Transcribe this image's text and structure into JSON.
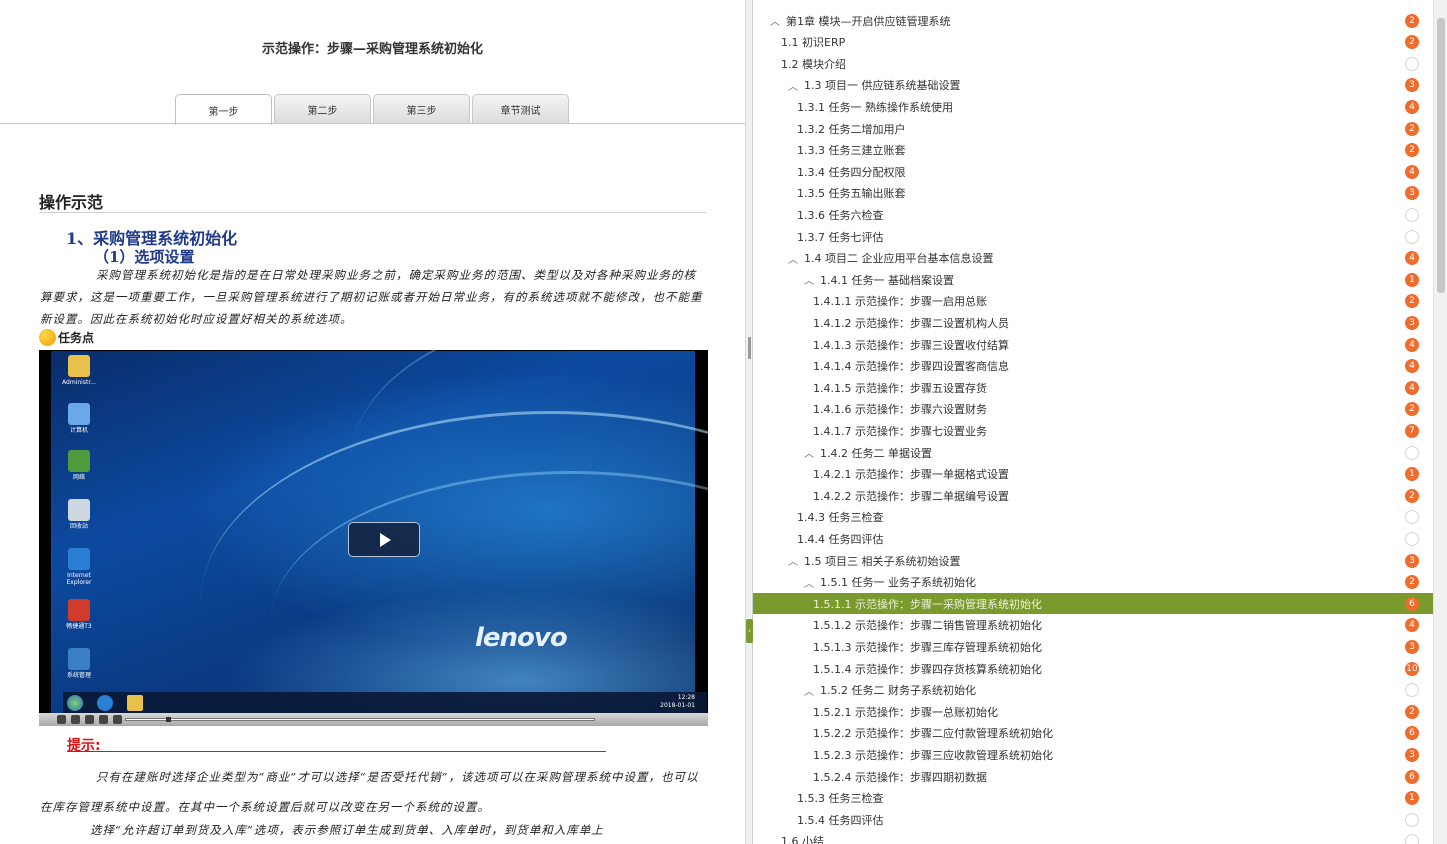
{
  "content": {
    "page_title": "示范操作：步骤—采购管理系统初始化",
    "tabs": [
      {
        "label": "第一步",
        "active": true
      },
      {
        "label": "第二步",
        "active": false
      },
      {
        "label": "第三步",
        "active": false
      },
      {
        "label": "章节测试",
        "active": false
      }
    ],
    "section_heading": "操作示范",
    "heading1": "1、采购管理系统初始化",
    "heading2": "（1）选项设置",
    "paragraph1": "采购管理系统初始化是指的是在日常处理采购业务之前，确定采购业务的范围、类型以及对各种采购业务的核算要求，这是一项重要工作，一旦采购管理系统进行了期初记账或者开始日常业务，有的系统选项就不能修改，也不能重新设置。因此在系统初始化时应设置好相关的系统选项。",
    "task_label": "任务点",
    "tip_label": "提示:",
    "paragraph2": "只有在建账时选择企业类型为“商业”才可以选择“是否受托代销”，该选项可以在采购管理系统中设置，也可以在库存管理系统中设置。在其中一个系统设置后就可以改变在另一个系统的设置。",
    "paragraph3": "选择“允许超订单到货及入库”选项，表示参照订单生成到货单、入库单时，到货单和入库单上"
  },
  "video": {
    "desktop_icons": [
      {
        "name": "folder-icon",
        "label": "Administr...",
        "color": "#e8c14a"
      },
      {
        "name": "computer-icon",
        "label": "计算机",
        "color": "#6aa9e8"
      },
      {
        "name": "network-icon",
        "label": "网络",
        "color": "#4f9a3c"
      },
      {
        "name": "recycle-bin-icon",
        "label": "回收站",
        "color": "#cfd8e0"
      },
      {
        "name": "ie-icon",
        "label": "Internet Explorer",
        "color": "#2a7fd4"
      },
      {
        "name": "app-icon",
        "label": "畅捷通T3",
        "color": "#d23a2a"
      },
      {
        "name": "system-manage-icon",
        "label": "系统管理",
        "color": "#3a7fc8"
      }
    ],
    "brand": "lenovo",
    "clock_time": "12:28",
    "clock_date": "2018-01-01"
  },
  "toc": [
    {
      "level": 0,
      "toggle": "^",
      "label": "第1章 模块—开启供应链管理系统",
      "badge": "2"
    },
    {
      "level": 1,
      "toggle": "",
      "label": "1.1 初识ERP",
      "badge": "2"
    },
    {
      "level": 1,
      "toggle": "",
      "label": "1.2 模块介绍",
      "badge": ""
    },
    {
      "level": 2,
      "toggle": "^",
      "label": "1.3 项目一 供应链系统基础设置",
      "badge": "3"
    },
    {
      "level": 3,
      "toggle": "",
      "label": "1.3.1 任务一 熟练操作系统使用",
      "badge": "4"
    },
    {
      "level": 3,
      "toggle": "",
      "label": "1.3.2 任务二增加用户",
      "badge": "2"
    },
    {
      "level": 3,
      "toggle": "",
      "label": "1.3.3 任务三建立账套",
      "badge": "2"
    },
    {
      "level": 3,
      "toggle": "",
      "label": "1.3.4 任务四分配权限",
      "badge": "4"
    },
    {
      "level": 3,
      "toggle": "",
      "label": "1.3.5 任务五输出账套",
      "badge": "3"
    },
    {
      "level": 3,
      "toggle": "",
      "label": "1.3.6 任务六检查",
      "badge": ""
    },
    {
      "level": 3,
      "toggle": "",
      "label": "1.3.7 任务七评估",
      "badge": ""
    },
    {
      "level": 2,
      "toggle": "^",
      "label": "1.4 项目二 企业应用平台基本信息设置",
      "badge": "4"
    },
    {
      "level": 4,
      "toggle": "^",
      "label": "1.4.1 任务一 基础档案设置",
      "badge": "1"
    },
    {
      "level": 5,
      "toggle": "",
      "label": "1.4.1.1 示范操作：步骤一启用总账",
      "badge": "2"
    },
    {
      "level": 5,
      "toggle": "",
      "label": "1.4.1.2 示范操作：步骤二设置机构人员",
      "badge": "3"
    },
    {
      "level": 5,
      "toggle": "",
      "label": "1.4.1.3 示范操作：步骤三设置收付结算",
      "badge": "4"
    },
    {
      "level": 5,
      "toggle": "",
      "label": "1.4.1.4 示范操作：步骤四设置客商信息",
      "badge": "4"
    },
    {
      "level": 5,
      "toggle": "",
      "label": "1.4.1.5 示范操作：步骤五设置存货",
      "badge": "4"
    },
    {
      "level": 5,
      "toggle": "",
      "label": "1.4.1.6 示范操作：步骤六设置财务",
      "badge": "2"
    },
    {
      "level": 5,
      "toggle": "",
      "label": "1.4.1.7 示范操作：步骤七设置业务",
      "badge": "7"
    },
    {
      "level": 4,
      "toggle": "^",
      "label": "1.4.2 任务二 单据设置",
      "badge": ""
    },
    {
      "level": 5,
      "toggle": "",
      "label": "1.4.2.1 示范操作：步骤一单据格式设置",
      "badge": "1"
    },
    {
      "level": 5,
      "toggle": "",
      "label": "1.4.2.2 示范操作：步骤二单据编号设置",
      "badge": "2"
    },
    {
      "level": 3,
      "toggle": "",
      "label": "1.4.3 任务三检查",
      "badge": ""
    },
    {
      "level": 3,
      "toggle": "",
      "label": "1.4.4 任务四评估",
      "badge": ""
    },
    {
      "level": 2,
      "toggle": "^",
      "label": "1.5 项目三 相关子系统初始设置",
      "badge": "3"
    },
    {
      "level": 4,
      "toggle": "^",
      "label": "1.5.1 任务一 业务子系统初始化",
      "badge": "2"
    },
    {
      "level": 5,
      "toggle": "",
      "label": "1.5.1.1 示范操作：步骤一采购管理系统初始化",
      "badge": "6",
      "selected": true
    },
    {
      "level": 5,
      "toggle": "",
      "label": "1.5.1.2 示范操作：步骤二销售管理系统初始化",
      "badge": "4"
    },
    {
      "level": 5,
      "toggle": "",
      "label": "1.5.1.3 示范操作：步骤三库存管理系统初始化",
      "badge": "3"
    },
    {
      "level": 5,
      "toggle": "",
      "label": "1.5.1.4 示范操作：步骤四存货核算系统初始化",
      "badge": "10"
    },
    {
      "level": 4,
      "toggle": "^",
      "label": "1.5.2 任务二 财务子系统初始化",
      "badge": ""
    },
    {
      "level": 5,
      "toggle": "",
      "label": "1.5.2.1 示范操作：步骤一总账初始化",
      "badge": "2"
    },
    {
      "level": 5,
      "toggle": "",
      "label": "1.5.2.2 示范操作：步骤二应付款管理系统初始化",
      "badge": "6"
    },
    {
      "level": 5,
      "toggle": "",
      "label": "1.5.2.3 示范操作：步骤三应收款管理系统初始化",
      "badge": "3"
    },
    {
      "level": 5,
      "toggle": "",
      "label": "1.5.2.4 示范操作：步骤四期初数据",
      "badge": "6"
    },
    {
      "level": 3,
      "toggle": "",
      "label": "1.5.3 任务三检查",
      "badge": "1"
    },
    {
      "level": 3,
      "toggle": "",
      "label": "1.5.4 任务四评估",
      "badge": ""
    },
    {
      "level": 1,
      "toggle": "",
      "label": "1.6 小结",
      "badge": ""
    }
  ],
  "colors": {
    "selected_row": "#7a9a2e",
    "badge": "#ef6c2d",
    "heading": "#1f3a8a",
    "tip": "#e01010"
  }
}
